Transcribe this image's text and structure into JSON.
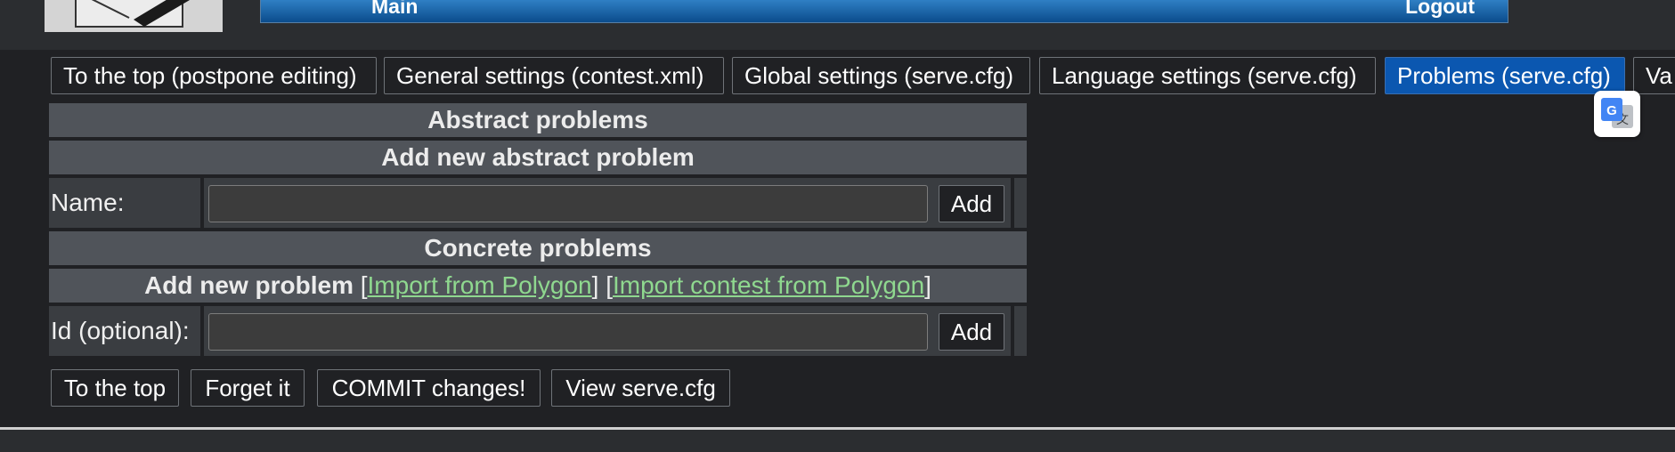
{
  "header": {
    "main_link": "Main",
    "logout_link": "Logout"
  },
  "tabs": [
    {
      "label": "To the top (postpone editing)"
    },
    {
      "label": "General settings (contest.xml)"
    },
    {
      "label": "Global settings (serve.cfg)"
    },
    {
      "label": "Language settings (serve.cfg)"
    },
    {
      "label": "Problems (serve.cfg)",
      "active": true
    },
    {
      "label": "Va"
    }
  ],
  "abstract": {
    "heading": "Abstract problems",
    "add_heading": "Add new abstract problem",
    "name_label": "Name:",
    "name_value": "",
    "add_button": "Add"
  },
  "concrete": {
    "heading": "Concrete problems",
    "add_heading": "Add new problem",
    "bracket_open": " [",
    "bracket_mid": "] [",
    "bracket_close": "]",
    "import_polygon": "Import from Polygon",
    "import_contest_polygon": "Import contest from Polygon",
    "id_label": "Id (optional):",
    "id_value": "",
    "add_button": "Add"
  },
  "bottom_buttons": {
    "to_top": "To the top",
    "forget": "Forget it",
    "commit": "COMMIT changes!",
    "view_cfg": "View serve.cfg"
  },
  "icons": {
    "translate": "google-translate-icon",
    "logo": "logo-image"
  },
  "colors": {
    "background": "#202124",
    "header_bar": "#0b4c8c",
    "section_header": "#50545a",
    "link": "#8fd88f",
    "active_tab": "#0b57b0"
  }
}
